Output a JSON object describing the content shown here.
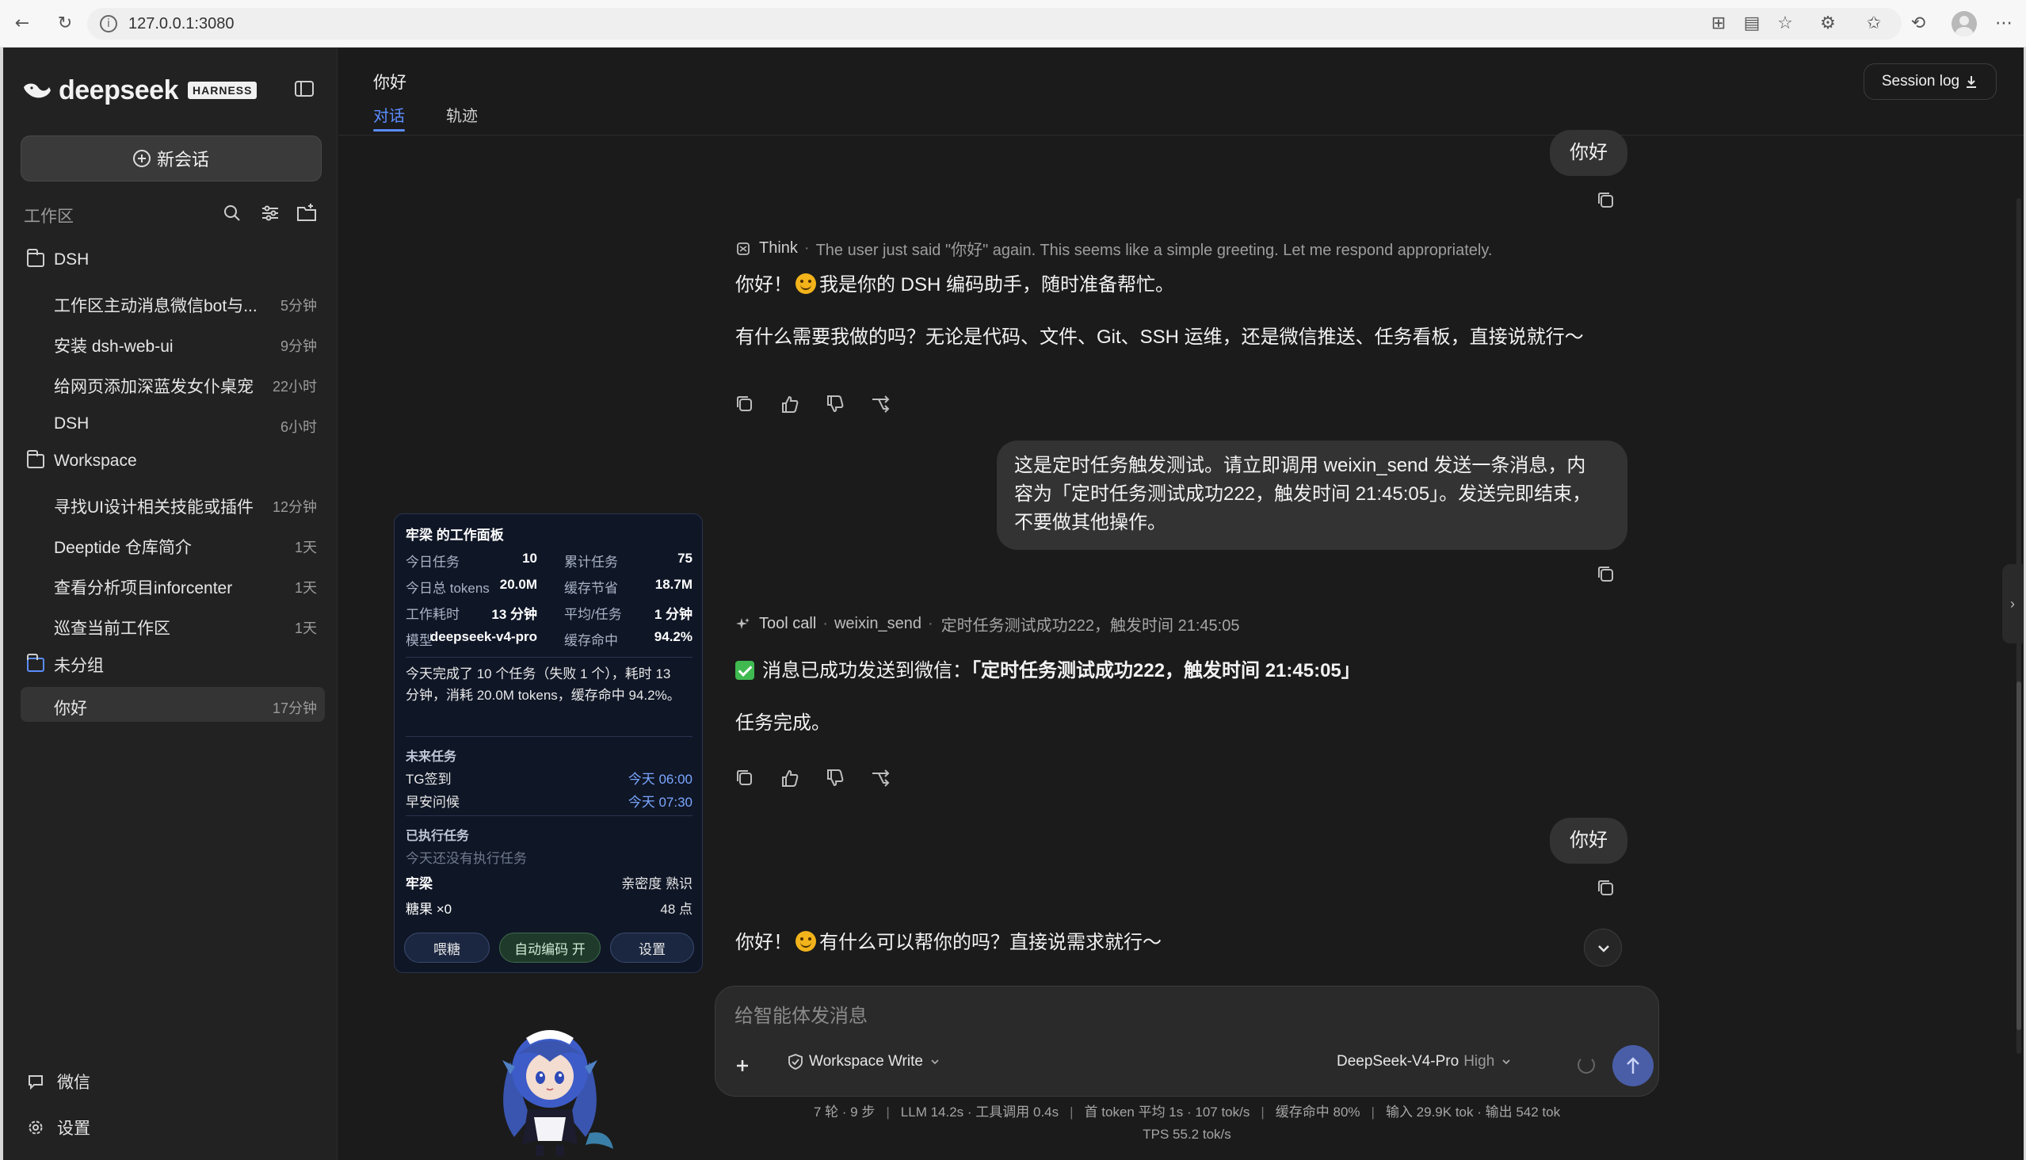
{
  "browser": {
    "url": "127.0.0.1:3080"
  },
  "sidebar": {
    "brand": "deepseek",
    "badge": "HARNESS",
    "new_chat": "新会话",
    "workspace_label": "工作区",
    "groups": [
      {
        "name": "DSH",
        "items": [
          {
            "label": "工作区主动消息微信bot与...",
            "time": "5分钟"
          },
          {
            "label": "安装 dsh-web-ui",
            "time": "9分钟"
          },
          {
            "label": "给网页添加深蓝发女仆桌宠",
            "time": "22小时"
          },
          {
            "label": "DSH",
            "time": "6小时"
          }
        ]
      },
      {
        "name": "Workspace",
        "items": [
          {
            "label": "寻找UI设计相关技能或插件",
            "time": "12分钟"
          },
          {
            "label": "Deeptide 仓库简介",
            "time": "1天"
          },
          {
            "label": "查看分析项目inforcenter",
            "time": "1天"
          },
          {
            "label": "巡查当前工作区",
            "time": "1天"
          }
        ]
      },
      {
        "name": "未分组",
        "items": [
          {
            "label": "你好",
            "time": "17分钟"
          }
        ]
      }
    ],
    "footer": {
      "wechat": "微信",
      "settings": "设置"
    }
  },
  "header": {
    "title": "你好",
    "tabs": [
      "对话",
      "轨迹"
    ],
    "session_log": "Session log"
  },
  "chat": {
    "user1": "你好",
    "think_label": "Think",
    "think_text": "The user just said \"你好\" again. This seems like a simple greeting. Let me respond appropriately.",
    "a1_line1_pre": "你好！",
    "a1_line1_post": "我是你的 DSH 编码助手，随时准备帮忙。",
    "a1_line2": "有什么需要我做的吗？无论是代码、文件、Git、SSH 运维，还是微信推送、任务看板，直接说就行～",
    "user2_lines": [
      "这是定时任务触发测试。请立即调用 weixin_send 发送一条消息，内",
      "容为「定时任务测试成功222，触发时间 21:45:05」。发送完即结束，",
      "不要做其他操作。"
    ],
    "tool_label": "Tool call",
    "tool_name": "weixin_send",
    "tool_args": "定时任务测试成功222，触发时间 21:45:05",
    "a2_line1_pre": "消息已成功发送到微信：",
    "a2_line1_bold": "「定时任务测试成功222，触发时间 21:45:05」",
    "a2_line2": "任务完成。",
    "user3": "你好",
    "a3_pre": "你好！",
    "a3_post": "有什么可以帮你的吗？直接说需求就行～"
  },
  "composer": {
    "placeholder": "给智能体发消息",
    "mode": "Workspace Write",
    "model": "DeepSeek-V4-Pro",
    "effort": "High"
  },
  "stats": {
    "line1": [
      "7 轮 · 9 步",
      "LLM 14.2s · 工具调用 0.4s",
      "首 token 平均 1s · 107 tok/s",
      "缓存命中 80%",
      "输入 29.9K tok · 输出 542 tok"
    ],
    "line2": "TPS 55.2 tok/s"
  },
  "dashboard": {
    "title": "牢梁 的工作面板",
    "rows": [
      {
        "k1": "今日任务",
        "v1": "10",
        "k2": "累计任务",
        "v2": "75"
      },
      {
        "k1": "今日总 tokens",
        "v1": "20.0M",
        "k2": "缓存节省",
        "v2": "18.7M"
      },
      {
        "k1": "工作耗时",
        "v1": "13 分钟",
        "k2": "平均/任务",
        "v2": "1 分钟"
      },
      {
        "k1": "模型",
        "v1": "deepseek-v4-pro",
        "k2": "缓存命中",
        "v2": "94.2%"
      }
    ],
    "summary": "今天完成了 10 个任务（失败 1 个），耗时 13 分钟，消耗 20.0M tokens，缓存命中 94.2%。",
    "future_title": "未来任务",
    "future": [
      {
        "name": "TG签到",
        "time": "今天 06:00"
      },
      {
        "name": "早安问候",
        "time": "今天 07:30"
      }
    ],
    "done_title": "已执行任务",
    "done_empty": "今天还没有执行任务",
    "pet_name": "牢梁",
    "pet_intimacy": "亲密度 熟识",
    "pet_candy": "糖果 ×0",
    "pet_points": "48 点",
    "btn_feed": "喂糖",
    "btn_auto": "自动编码 开",
    "btn_settings": "设置"
  }
}
